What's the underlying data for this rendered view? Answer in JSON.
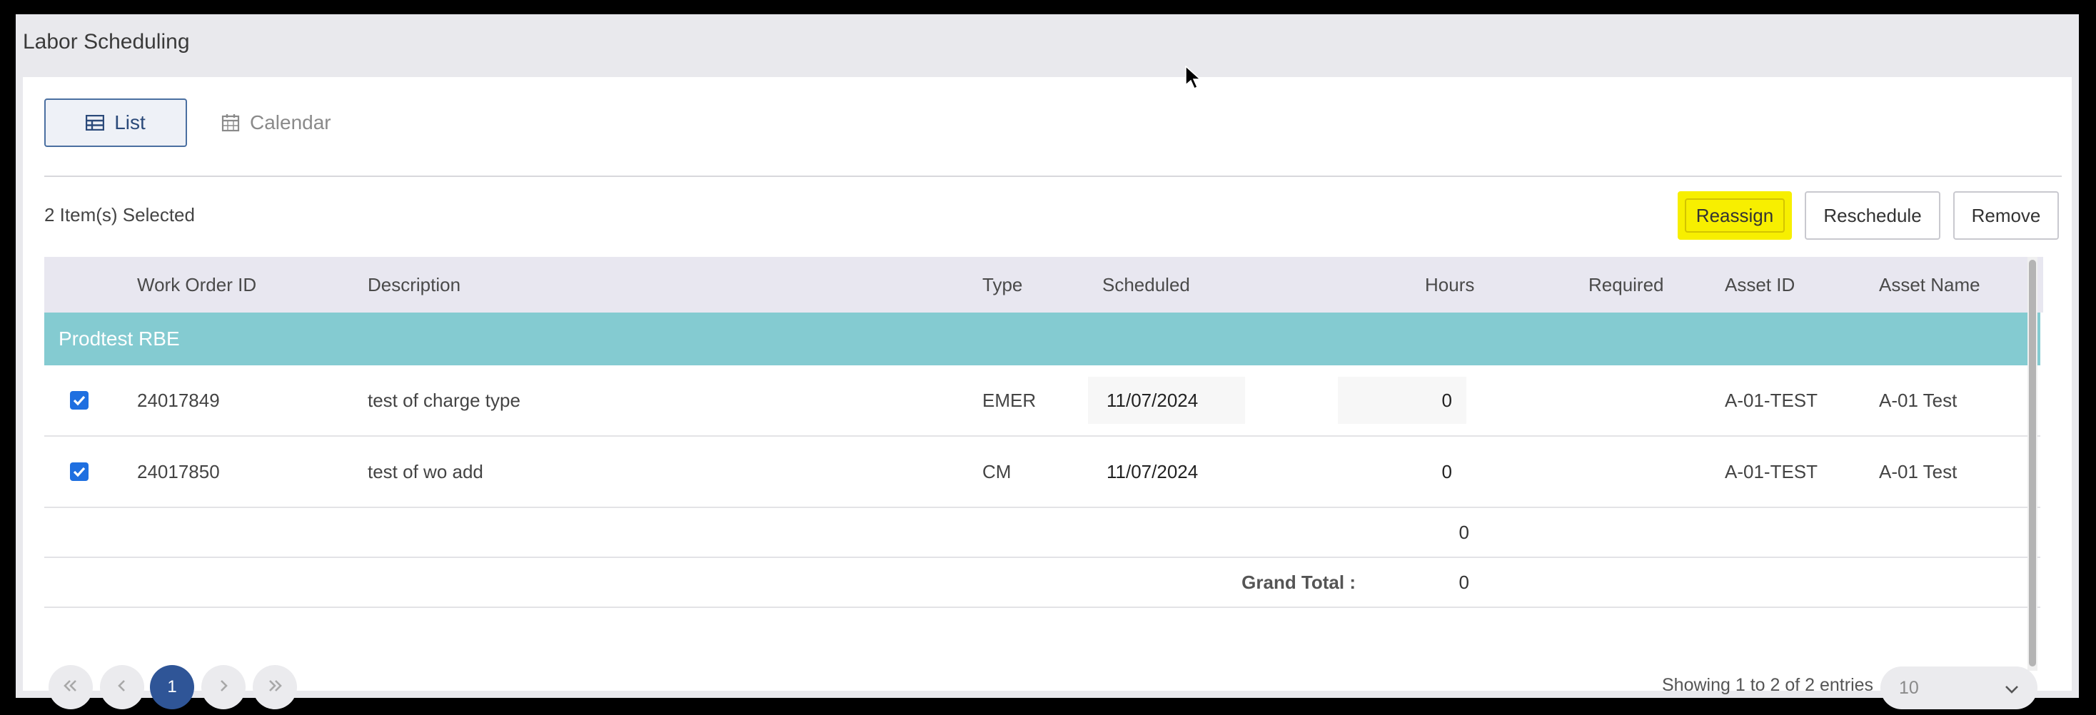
{
  "app": {
    "title": "Labor Scheduling"
  },
  "view_tabs": [
    {
      "label": "List",
      "icon": "table-icon",
      "active": true
    },
    {
      "label": "Calendar",
      "icon": "calendar-icon",
      "active": false
    }
  ],
  "toolbar": {
    "selected_text": "2 Item(s) Selected",
    "reassign_label": "Reassign",
    "reschedule_label": "Reschedule",
    "remove_label": "Remove",
    "highlight_color": "#f7ef00"
  },
  "table": {
    "columns": [
      "Work Order ID",
      "Description",
      "Type",
      "Scheduled",
      "Hours",
      "Required",
      "Asset ID",
      "Asset Name"
    ],
    "group": {
      "label": "Prodtest RBE",
      "color": "#84cbd1"
    },
    "rows": [
      {
        "checked": true,
        "work_order_id": "24017849",
        "description": "test of charge type",
        "type": "EMER",
        "scheduled": "11/07/2024",
        "hours": "0",
        "required": "",
        "asset_id": "A-01-TEST",
        "asset_name": "A-01 Test"
      },
      {
        "checked": true,
        "work_order_id": "24017850",
        "description": "test of wo add",
        "type": "CM",
        "scheduled": "11/07/2024",
        "hours": "0",
        "required": "",
        "asset_id": "A-01-TEST",
        "asset_name": "A-01 Test"
      }
    ],
    "subtotal_hours": "0",
    "grand_total_label": "Grand Total :",
    "grand_total_hours": "0"
  },
  "pagination": {
    "current_page": "1",
    "entries_text": "Showing 1 to 2 of 2 entries",
    "page_size": "10",
    "active_color": "#2f5597"
  }
}
